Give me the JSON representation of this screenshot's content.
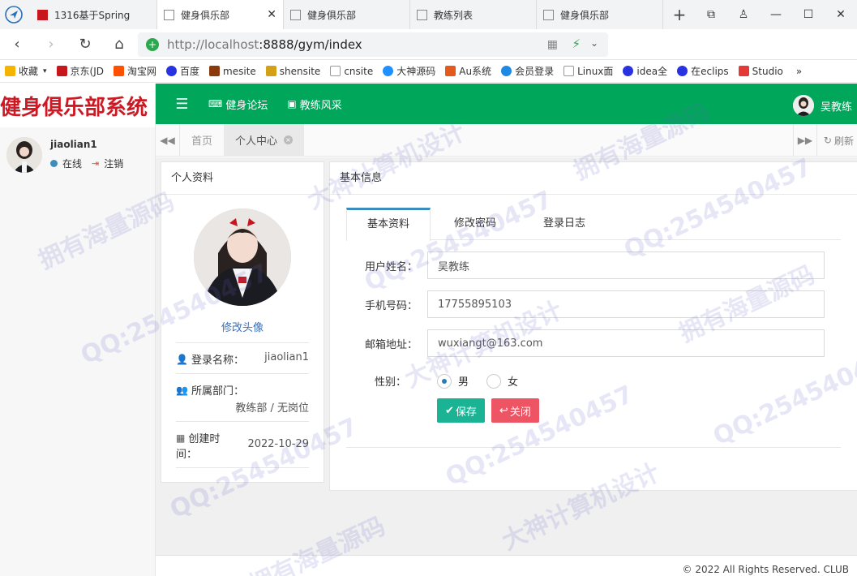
{
  "browser": {
    "tabs": [
      {
        "title": "1316基于Spring",
        "active": false
      },
      {
        "title": "健身俱乐部",
        "active": true
      },
      {
        "title": "健身俱乐部",
        "active": false
      },
      {
        "title": "教练列表",
        "active": false
      },
      {
        "title": "健身俱乐部",
        "active": false
      }
    ],
    "url_host": "http://localhost",
    "url_path": ":8888/gym/index",
    "bookmarks": [
      {
        "label": "收藏",
        "color": "#f4b400"
      },
      {
        "label": "京东(JD",
        "color": "#c8161d"
      },
      {
        "label": "淘宝网",
        "color": "#ff5000"
      },
      {
        "label": "百度",
        "color": "#2932e1"
      },
      {
        "label": "mesite",
        "color": "#8b3a0e"
      },
      {
        "label": "shensite",
        "color": "#d4a017"
      },
      {
        "label": "cnsite",
        "color": "#999999"
      },
      {
        "label": "大神源码",
        "color": "#1e90ff"
      },
      {
        "label": "Au系统",
        "color": "#e55a1c"
      },
      {
        "label": "会员登录",
        "color": "#1e88e5"
      },
      {
        "label": "Linux面",
        "color": "#999999"
      },
      {
        "label": "idea全",
        "color": "#2932e1"
      },
      {
        "label": "在eclips",
        "color": "#2932e1"
      },
      {
        "label": "Studio",
        "color": "#e53935"
      }
    ],
    "bookmarks_more": "»"
  },
  "app": {
    "logo": "健身俱乐部系统",
    "sidebar_user": {
      "name": "jiaolian1",
      "online": "在线",
      "logout": "注销"
    },
    "topnav": [
      {
        "label": "健身论坛"
      },
      {
        "label": "教练风采"
      }
    ],
    "top_user": "吴教练",
    "content_tabs": [
      {
        "label": "首页",
        "active": false
      },
      {
        "label": "个人中心",
        "active": true
      }
    ],
    "refresh": "刷新",
    "footer": "© 2022 All Rights Reserved. CLUB"
  },
  "profile": {
    "title": "个人资料",
    "change_avatar": "修改头像",
    "login_name_label": "登录名称：",
    "login_name": "jiaolian1",
    "dept_label": "所属部门：",
    "dept": "教练部 / 无岗位",
    "created_label_1": "创建时",
    "created_label_2": "间：",
    "created": "2022-10-29"
  },
  "basic": {
    "title": "基本信息",
    "tabs": [
      "基本资料",
      "修改密码",
      "登录日志"
    ],
    "fields": [
      {
        "label": "用户姓名：",
        "value": "吴教练"
      },
      {
        "label": "手机号码：",
        "value": "17755895103"
      },
      {
        "label": "邮箱地址：",
        "value": "wuxiangt@163.com"
      }
    ],
    "gender_label": "性别：",
    "gender_options": [
      "男",
      "女"
    ],
    "gender_selected": "男",
    "save": "保存",
    "close": "关闭"
  },
  "watermarks": [
    "QQ:254540457",
    "拥有海量源码",
    "大神计算机设计"
  ]
}
